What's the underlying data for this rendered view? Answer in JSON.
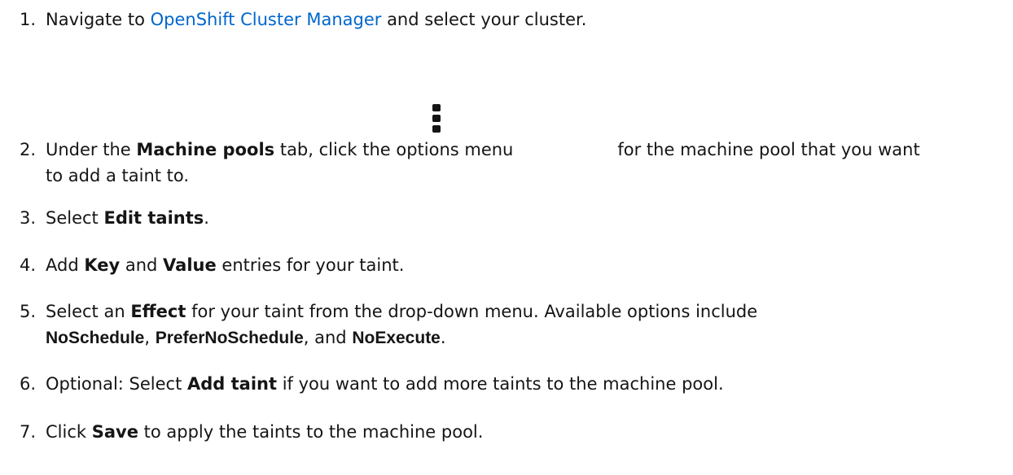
{
  "steps": [
    {
      "num": "1.",
      "pre": "Navigate to ",
      "link": "OpenShift Cluster Manager",
      "post": " and select your cluster."
    },
    {
      "num": "2.",
      "pre": "Under the ",
      "bold": "Machine pools",
      "mid": " tab, click the options menu",
      "post": "for the machine pool that you want",
      "line2": "to add a taint to.",
      "icon": "kebab-menu-icon"
    },
    {
      "num": "3.",
      "pre": "Select ",
      "bold": "Edit taints",
      "post": "."
    },
    {
      "num": "4.",
      "pre": "Add ",
      "bold1": "Key",
      "mid": " and ",
      "bold2": "Value",
      "post": " entries for your taint."
    },
    {
      "num": "5.",
      "pre": "Select an ",
      "bold": "Effect",
      "post": " for your taint from the drop-down menu. Available options include",
      "opt1": "NoSchedule",
      "sep1": ", ",
      "opt2": "PreferNoSchedule",
      "sep2": ", and ",
      "opt3": "NoExecute",
      "end": "."
    },
    {
      "num": "6.",
      "pre": "Optional: Select ",
      "bold": "Add taint",
      "post": " if you want to add more taints to the machine pool."
    },
    {
      "num": "7.",
      "pre": "Click ",
      "bold": "Save",
      "post": " to apply the taints to the machine pool."
    }
  ],
  "colors": {
    "text": "#151515",
    "link": "#0066cc"
  }
}
